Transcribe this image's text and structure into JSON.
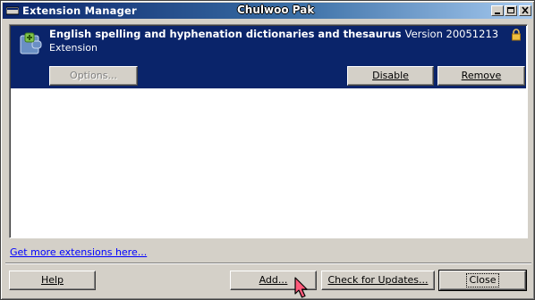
{
  "window": {
    "title": "Extension Manager",
    "user_name": "Chulwoo Pak"
  },
  "extension": {
    "name": "English spelling and hyphenation dictionaries and thesaurus",
    "version_text": "Version 20051213",
    "type": "Extension",
    "icon": "puzzle-piece-icon",
    "locked_icon": "lock-icon",
    "options_label": "Options...",
    "disable_label": "Disable",
    "remove_label": "Remove"
  },
  "link": {
    "get_more": "Get more extensions here..."
  },
  "buttons": {
    "help": "Help",
    "add": "Add...",
    "check_updates": "Check for Updates...",
    "close": "Close"
  },
  "colors": {
    "selection": "#0a246a",
    "titlebar_start": "#0a246a",
    "titlebar_end": "#a6caf0",
    "link": "#0000ff",
    "face": "#d4d0c8"
  }
}
